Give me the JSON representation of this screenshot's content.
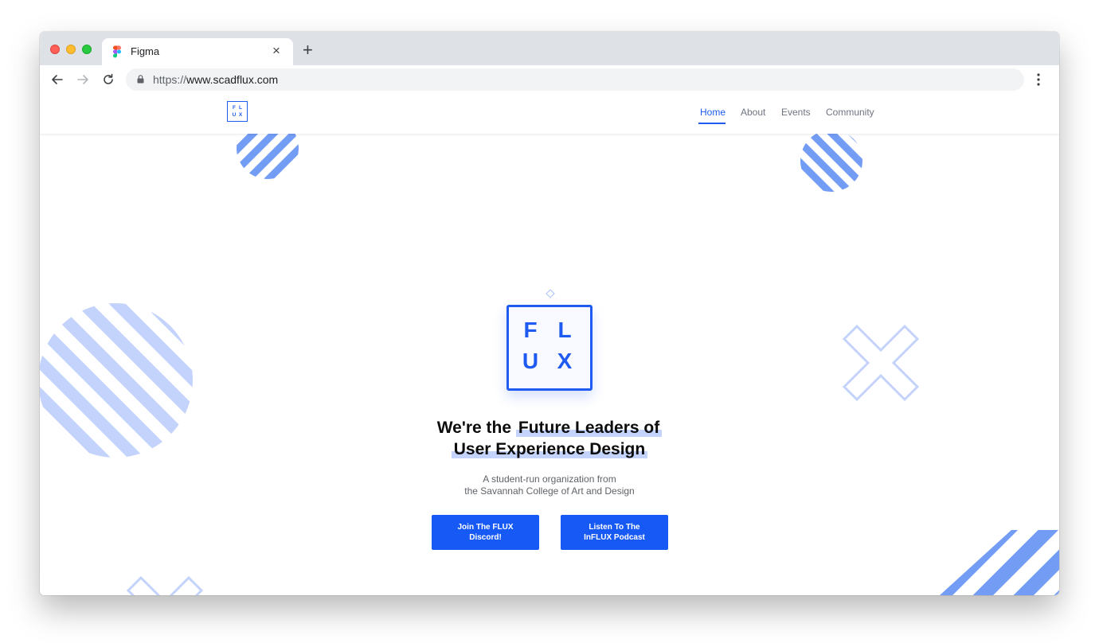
{
  "browser": {
    "tab_title": "Figma",
    "tab_close_glyph": "×",
    "new_tab_glyph": "+",
    "url_scheme": "https://",
    "url_host": "www.scadflux.com",
    "icons": [
      "back-arrow-icon",
      "forward-arrow-icon",
      "reload-icon",
      "lock-icon",
      "more-menu-icon",
      "figma-favicon-icon"
    ]
  },
  "site": {
    "logo_letters": [
      "F",
      "L",
      "U",
      "X"
    ],
    "nav": [
      {
        "label": "Home",
        "active": true
      },
      {
        "label": "About",
        "active": false
      },
      {
        "label": "Events",
        "active": false
      },
      {
        "label": "Community",
        "active": false
      }
    ],
    "hero": {
      "logo_letters": [
        "F",
        "L",
        "U",
        "X"
      ],
      "headline_plain": "We're the ",
      "headline_highlight_1": "Future Leaders of",
      "headline_highlight_2": "User Experience Design",
      "subtitle_line1": "A student-run organization from",
      "subtitle_line2": "the Savannah College of Art and Design",
      "buttons": [
        "Join The FLUX Discord!",
        "Listen To The InFLUX Podcast"
      ]
    }
  },
  "colors": {
    "brand_blue": "#1f5bf0",
    "button_blue": "#1759f5",
    "decoration_light": "#c3d3fb",
    "decoration_medium": "#739df5"
  }
}
